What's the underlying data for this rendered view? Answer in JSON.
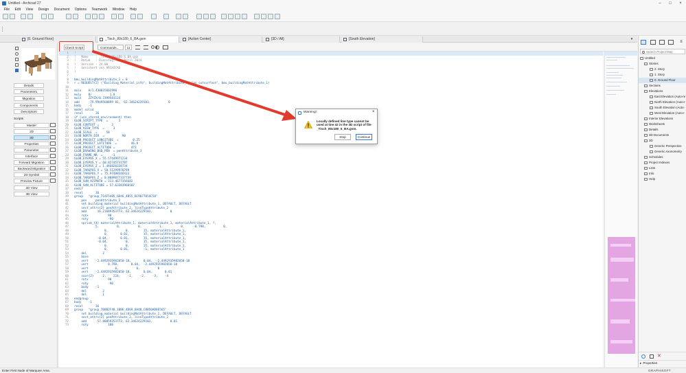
{
  "app": {
    "title": "Untitled - Archicad 27"
  },
  "menu": [
    "File",
    "Edit",
    "View",
    "Design",
    "Document",
    "Options",
    "Teamwork",
    "Window",
    "Help"
  ],
  "tabs": [
    "[0. Ground Floor]",
    "_Tisch_80x180_6_BA.gsm",
    "[Action Center]",
    "[3D / All]",
    "[South Elevation]"
  ],
  "left_panel": {
    "nav": [
      "Details",
      "Parameters",
      "Migration",
      "Components",
      "Descriptors"
    ],
    "scripts_label": "Scripts",
    "scripts": [
      "Master",
      "2D",
      "3D",
      "Properties",
      "Parameter",
      "Interface",
      "Forward Migration",
      "Backward Migration",
      "2D Symbol",
      "Preview Picture",
      "2D View",
      "3D View"
    ],
    "active_script": "3D"
  },
  "editor": {
    "check_script": "Check Script",
    "commands": "Commands...",
    "font_size": "11"
  },
  "code_lines": [
    "!",
    "!   Name    : _Tisch_80x180_6_BA.gsm",
    "!   Datum   : Dienstag, 30. April 2024",
    "!   Version : 24.00",
    "!   Gesichert von ARCHICAD",
    "!",
    "",
    "bmu_buildingMatAttribute_1 = 0",
    "r = REQUEST{2} (\"Building_Material_info\", buildingMatAttribute_1, \"gs_cutsurface\", bmu_buildingMatAttribute_1)",
    "",
    "mulx    A/1.430035602990",
    "muly    B/          1.8",
    "mulz    ZZYZX/0.7399581124",
    "add     -79.9949568899 81, -62.34624229183,          0",
    "body    -1",
    "model solid",
    "resol       36",
    "if (use_stored_environment) then",
    "GLOB_SCRIPT_TYPE  =      3",
    "GLOB_CONTEXT =       3",
    "GLOB_VIEW_TYPE  =     3",
    "GLOB_SCALE  =     50",
    "GLOB_NORTH_DIR  =          90",
    "GLOB_PROJECT_LONGITUDE  =        0.25",
    "GLOB_PROJECT_LATITUDE  =        46.9",
    "GLOB_PROJECT_ALTITUDE =         473",
    "GLOB_DRAWING_BGD_PEN  = penAttribute_3",
    "GLOB_FRAME_NR  =     -1",
    "GLOB_EYEPOS_X = 55.57449971234",
    "GLOB_EYEPOS_Y = 60.82745731787",
    "GLOB_EYEPOS_Z = 1.446820338734",
    "GLOB_TARGPOS_X = 50.51299978799",
    "GLOB_TARGPOS_Y = 75.97488346433",
    "GLOB_TARGPOS_Z = 0.8889877337739",
    "GLOB_SUN_AZIMUTH = 313.4677356682",
    "GLOB_SUN_ALTITUDE = 57.63383960107",
    "endif",
    "resol       36",
    "group   \"group_71AF5405_6D46_4B55_BC9077054C58\"",
    "    pen     penAttribute_2",
    "    set building_material buildingMatAttribute_1, DEFAULT, DEFAULT",
    "    sect_attrs{2} penAttribute_2, lineTypeAttribute_2",
    "    add      16.21689353773, 62.34624229183,          0",
    "    rotx           90",
    "    roty           -90",
    "    sprism_{4} materialAttribute_1, materialAttribute_1, materialAttribute_1, ?,",
    "            5,          0,          0,          1,          0,     -0.798,          0,",
    "                 0,          0,        15, materialAttribute_1,",
    "                 0,       0.01,        15, materialAttribute_1,",
    "             -0.04,       0.01,        15, materialAttribute_1,",
    "             -0.04,          0,        15, materialAttribute_1,",
    "                 0,          0,        15, materialAttribute_1,",
    "                 0,       0.01,        -1, materialAttribute_1",
    "    del         2",
    "    base",
    "    vert    -2.4492935982058-18,       0.04,  -2.4492935982058-18",
    "    vert           0.798,       0.04,  -2.4492935982058-18",
    "    vert               0,          0,          0",
    "    vert    -2.4492935982058-18,       0.04,       0.01",
    "    coor{2}     2,    224,    -1,    -2,    -3,    -4",
    "    rotx           90",
    "    roty           -90",
    "    body    -1",
    "    del         2",
    "    del         1",
    "endgroup",
    "body    -1",
    "resol       36",
    "group   \"group_7B8B2F48_1B0E_4D69_8A48_C8B50AD8E565\"",
    "    set building_material buildingMatAttribute_1, DEFAULT, DEFAULT",
    "    sect_attrs{2} penAttribute_2, lineTypeAttribute_2",
    "    add      57.88859353773, 62.34624229183,          0.01",
    "    roty           180"
  ],
  "navigator": {
    "search_placeholder": "Search Project Map",
    "items": [
      "Untitled",
      "Stories",
      "2. Story",
      "1. Story",
      "0. Ground Floor",
      "Sections",
      "Elevations",
      "East Elevation (Auto-re",
      "North Elevation (Auto-r",
      "South Elevation (Auto-",
      "West Elevation (Auto-r",
      "Interior Elevations",
      "Worksheets",
      "Details",
      "3D Documents",
      "3D",
      "Generic Perspective",
      "Generic Axonometry",
      "Schedules",
      "Project Indexes",
      "Lists",
      "Info",
      "Help"
    ],
    "properties_label": "Properties",
    "brand": "GRAPHISOFT"
  },
  "dialog": {
    "title": "Warning!",
    "message": "Locally defined line type cannot be used at line 42 in the 3D script of file _Tisch_80x180_6_BA.gsm.",
    "stop_label": "Stop",
    "continue_label": "Continue"
  },
  "status": {
    "text": "Enter First Node of Marquee Area."
  },
  "colors": {
    "annotation": "#e23b2e",
    "accent": "#3a78c3",
    "code_keyword": "#1d5fa8"
  }
}
